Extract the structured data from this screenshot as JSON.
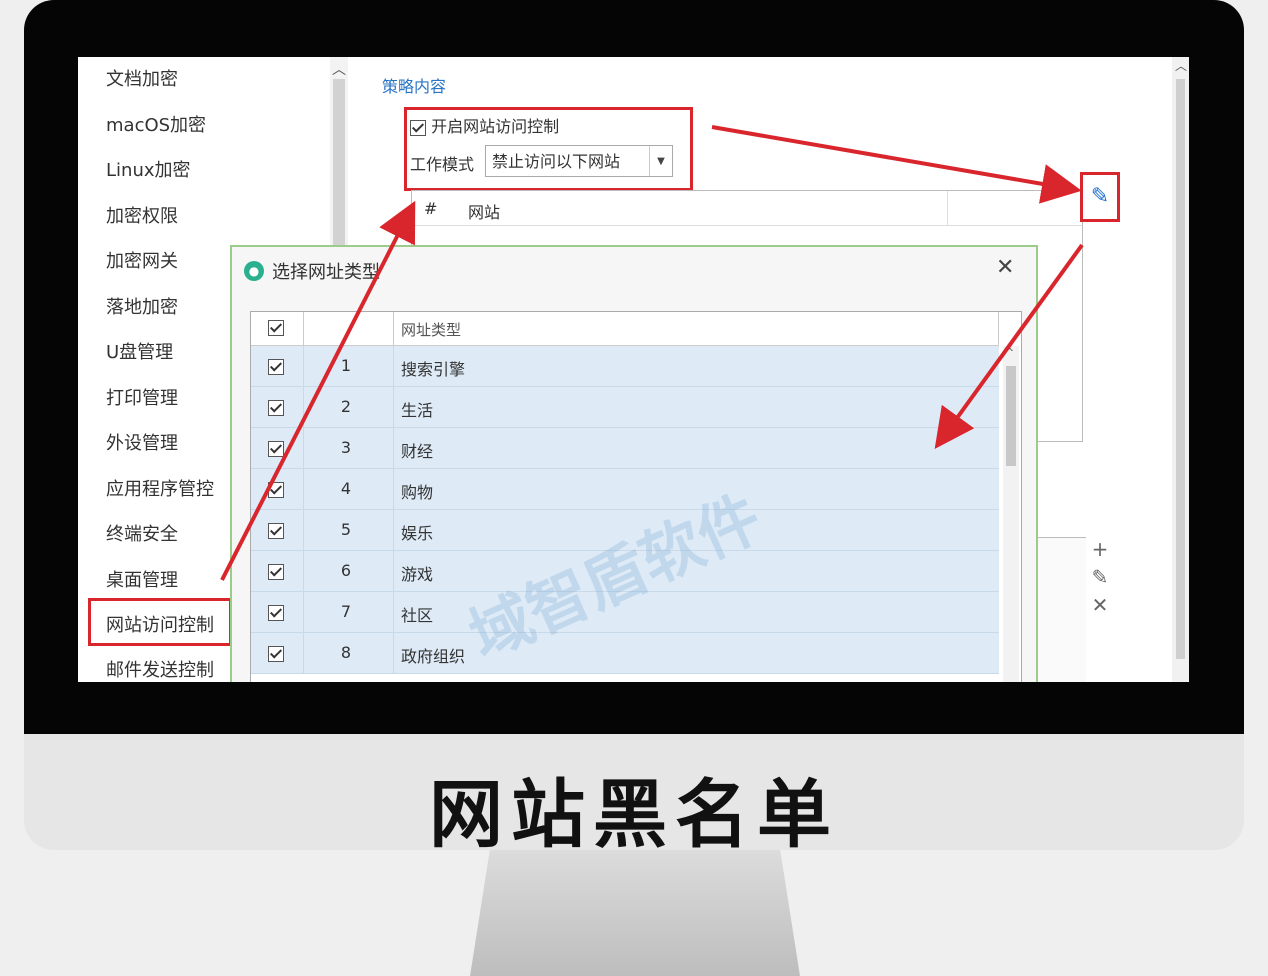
{
  "sidebar": {
    "items": [
      {
        "label": "文档加密"
      },
      {
        "label": "macOS加密"
      },
      {
        "label": "Linux加密"
      },
      {
        "label": "加密权限"
      },
      {
        "label": "加密网关"
      },
      {
        "label": "落地加密"
      },
      {
        "label": "U盘管理"
      },
      {
        "label": "打印管理"
      },
      {
        "label": "外设管理"
      },
      {
        "label": "应用程序管控"
      },
      {
        "label": "终端安全"
      },
      {
        "label": "桌面管理"
      },
      {
        "label": "网站访问控制"
      },
      {
        "label": "邮件发送控制"
      }
    ],
    "selected_index": 12
  },
  "content": {
    "section_title": "策略内容",
    "enable_label": "开启网站访问控制",
    "enable_checked": true,
    "mode_label": "工作模式",
    "mode_value": "禁止访问以下网站",
    "table_headers": {
      "index": "#",
      "site": "网站"
    }
  },
  "dialog": {
    "title": "选择网址类型",
    "column_header": "网址类型",
    "rows": [
      {
        "num": "1",
        "name": "搜索引擎",
        "checked": true
      },
      {
        "num": "2",
        "name": "生活",
        "checked": true
      },
      {
        "num": "3",
        "name": "财经",
        "checked": true
      },
      {
        "num": "4",
        "name": "购物",
        "checked": true
      },
      {
        "num": "5",
        "name": "娱乐",
        "checked": true
      },
      {
        "num": "6",
        "name": "游戏",
        "checked": true
      },
      {
        "num": "7",
        "name": "社区",
        "checked": true
      },
      {
        "num": "8",
        "name": "政府组织",
        "checked": true
      }
    ]
  },
  "icons": {
    "edit": "pencil-icon",
    "add": "plus-icon",
    "remove": "x-icon",
    "dialog": "globe-icon",
    "close": "close-icon"
  },
  "colors": {
    "highlight": "#d9262c",
    "link_blue": "#2a74c4",
    "row_blue": "#deebf7"
  },
  "caption": "网站黑名单",
  "watermark": "域智盾软件"
}
